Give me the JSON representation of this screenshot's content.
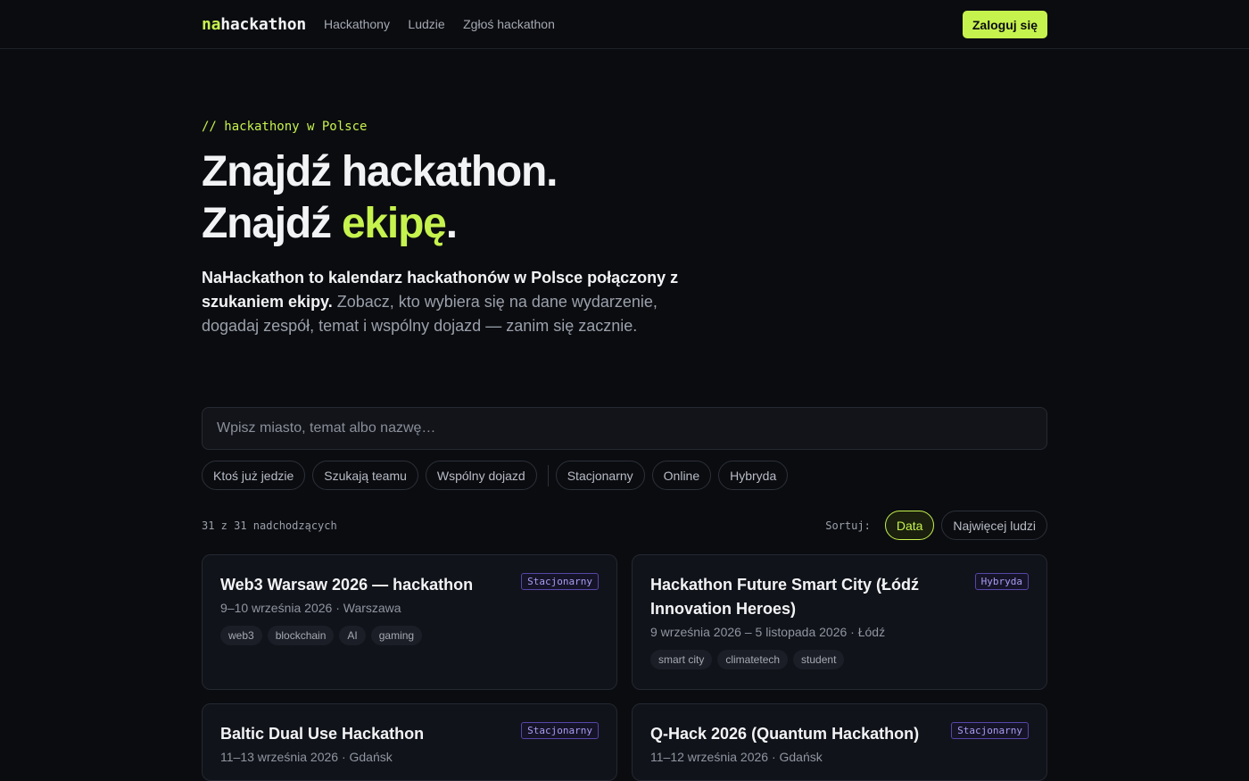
{
  "header": {
    "logo_prefix": "na",
    "logo_rest": "hackathon",
    "nav": [
      "Hackathony",
      "Ludzie",
      "Zgłoś hackathon"
    ],
    "login_label": "Zaloguj się"
  },
  "hero": {
    "kicker": "// hackathony w Polsce",
    "line1": "Znajdź hackathon.",
    "line2_prefix": "Znajdź ",
    "line2_accent": "ekipę",
    "line2_suffix": ".",
    "lede_strong": "NaHackathon to kalendarz hackathonów w Polsce połączony z szukaniem ekipy.",
    "lede_rest": " Zobacz, kto wybiera się na dane wydarzenie, dogadaj zespół, temat i wspólny dojazd — zanim się zacznie."
  },
  "search": {
    "placeholder": "Wpisz miasto, temat albo nazwę…",
    "value": ""
  },
  "filters": {
    "social": [
      "Ktoś już jedzie",
      "Szukają teamu",
      "Wspólny dojazd"
    ],
    "format": [
      "Stacjonarny",
      "Online",
      "Hybryda"
    ]
  },
  "results": {
    "count_text": "31 z 31 nadchodzących",
    "sort_label": "Sortuj:",
    "sort_options": [
      "Data",
      "Najwięcej ludzi"
    ],
    "sort_active": "Data"
  },
  "colors": {
    "accent": "#c6f24e",
    "background": "#0b0c10",
    "badge": "#a99cf3"
  },
  "events": [
    {
      "title": "Web3 Warsaw 2026 — hackathon",
      "badge": "Stacjonarny",
      "meta": "9–10 września 2026 · Warszawa",
      "tags": [
        "web3",
        "blockchain",
        "AI",
        "gaming"
      ]
    },
    {
      "title": "Hackathon Future Smart City (Łódź Innovation Heroes)",
      "badge": "Hybryda",
      "meta": "9 września 2026 – 5 listopada 2026 · Łódź",
      "tags": [
        "smart city",
        "climatetech",
        "student"
      ]
    },
    {
      "title": "Baltic Dual Use Hackathon",
      "badge": "Stacjonarny",
      "meta": "11–13 września 2026 · Gdańsk",
      "tags": []
    },
    {
      "title": "Q-Hack 2026 (Quantum Hackathon)",
      "badge": "Stacjonarny",
      "meta": "11–12 września 2026 · Gdańsk",
      "tags": []
    }
  ]
}
